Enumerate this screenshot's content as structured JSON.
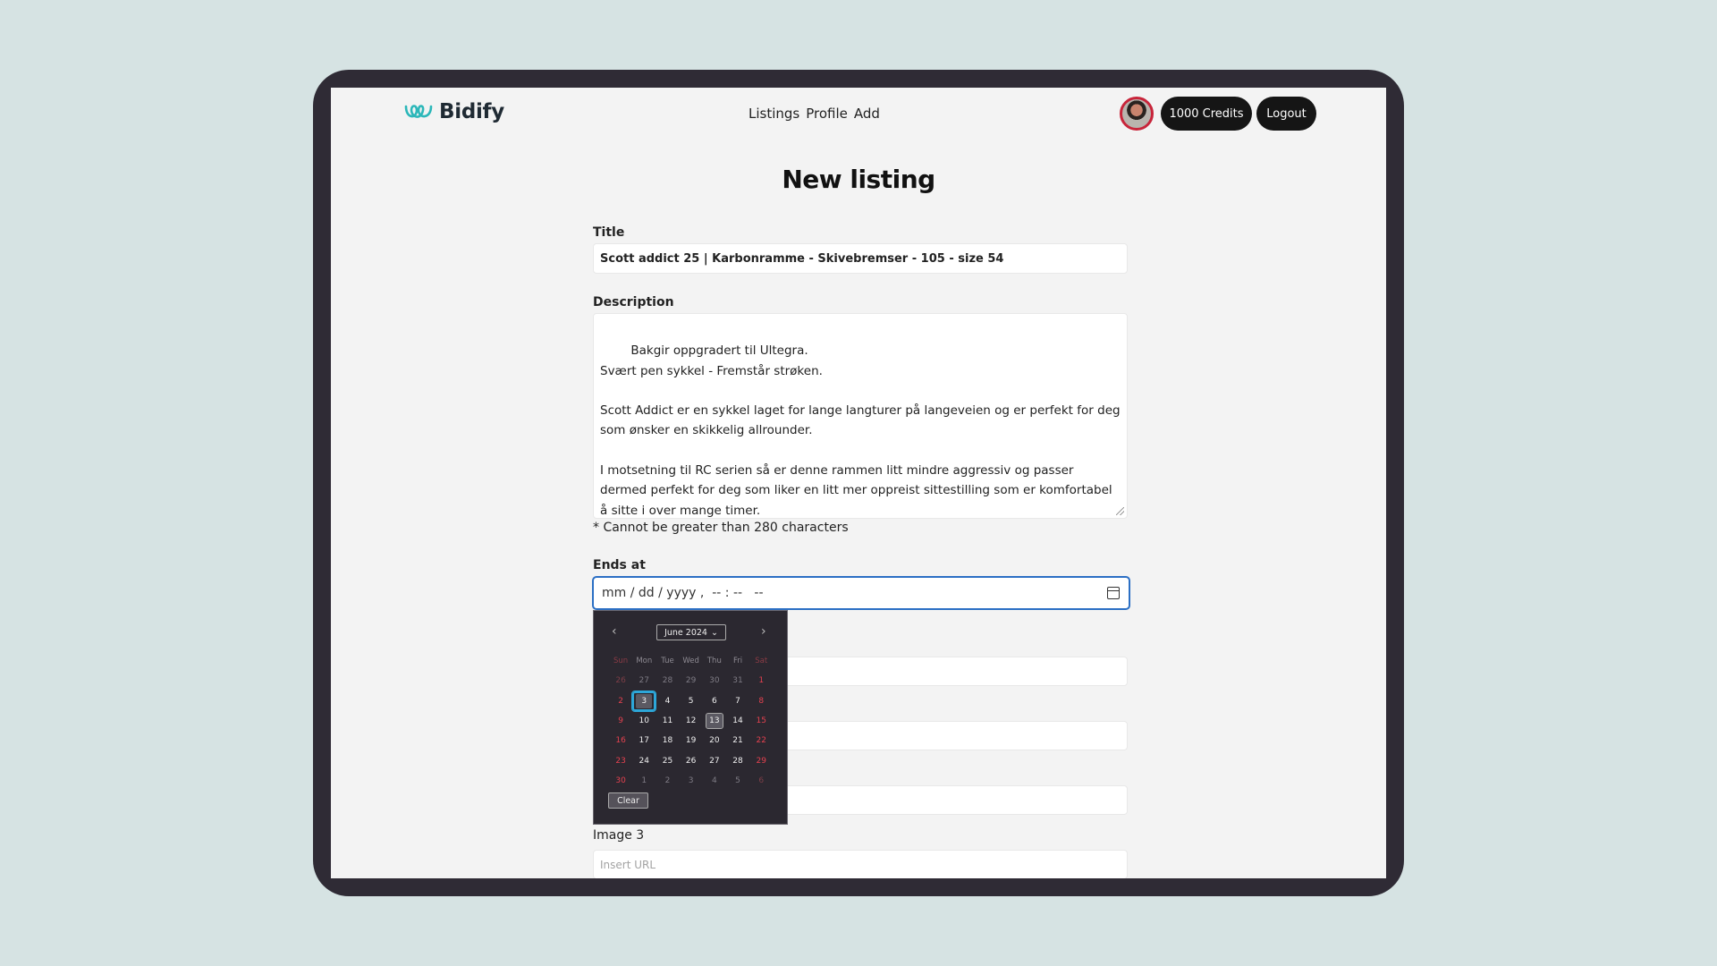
{
  "brand": {
    "name": "Bidify",
    "accent": "#2bb7b9"
  },
  "nav": {
    "listings": "Listings",
    "profile": "Profile",
    "add": "Add"
  },
  "header": {
    "credits": "1000 Credits",
    "logout": "Logout"
  },
  "page": {
    "title": "New listing"
  },
  "form": {
    "title_label": "Title",
    "title_value": "Scott addict 25 | Karbonramme - Skivebremser - 105 - size 54",
    "description_label": "Description",
    "description_value": "Bakgir oppgradert til Ultegra.\nSvært pen sykkel - Fremstår strøken.\n\nScott Addict er en sykkel laget for lange langturer på langeveien og er perfekt for deg som ønsker en skikkelig allrounder.\n\nI motsetning til RC serien så er denne rammen litt mindre aggressiv og passer dermed perfekt for deg som liker en litt mer oppreist sittestilling som er komfortabel å sitte i over mange timer.",
    "description_hint": "* Cannot be greater than 280 characters",
    "ends_label": "Ends at",
    "ends_value": "mm / dd / yyyy ,  -- : --   --",
    "image3_label": "Image 3",
    "image3_placeholder": "Insert URL"
  },
  "datepicker": {
    "month_label": "June 2024",
    "clear": "Clear",
    "weekdays": [
      "Sun",
      "Mon",
      "Tue",
      "Wed",
      "Thu",
      "Fri",
      "Sat"
    ],
    "weeks": [
      [
        "26",
        "27",
        "28",
        "29",
        "30",
        "31",
        "1"
      ],
      [
        "2",
        "3",
        "4",
        "5",
        "6",
        "7",
        "8"
      ],
      [
        "9",
        "10",
        "11",
        "12",
        "13",
        "14",
        "15"
      ],
      [
        "16",
        "17",
        "18",
        "19",
        "20",
        "21",
        "22"
      ],
      [
        "23",
        "24",
        "25",
        "26",
        "27",
        "28",
        "29"
      ],
      [
        "30",
        "1",
        "2",
        "3",
        "4",
        "5",
        "6"
      ]
    ],
    "today": "3",
    "selected": "13"
  }
}
